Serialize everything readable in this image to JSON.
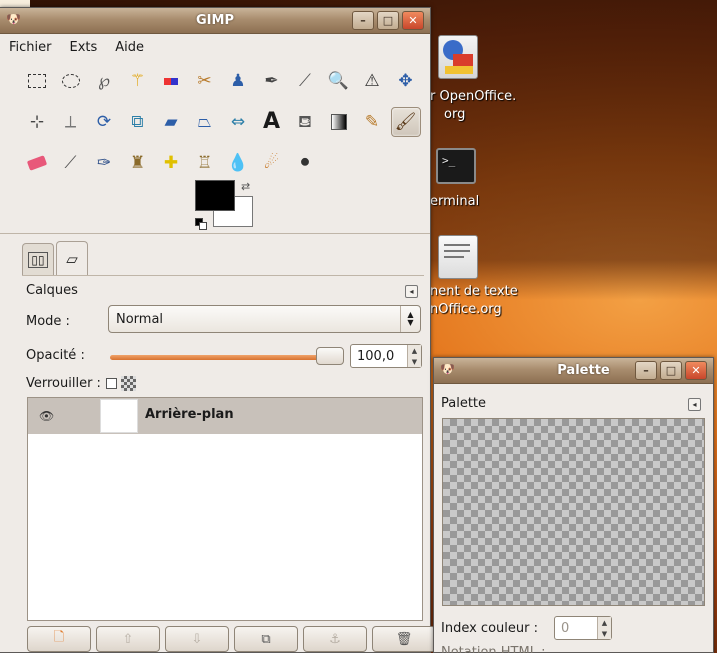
{
  "desktop": {
    "icons": [
      {
        "label_line1": "r OpenOffice.",
        "label_line2": "org",
        "icon": "openoffice-calc-icon"
      },
      {
        "label_line1": "erminal",
        "label_line2": "",
        "icon": "terminal-icon"
      },
      {
        "label_line1": "nent de texte",
        "label_line2": "nOffice.org",
        "icon": "openoffice-writer-icon"
      }
    ],
    "colors": {
      "wallpaper": "#e3741b",
      "panel": "#efebe7"
    }
  },
  "gimp": {
    "title": "GIMP",
    "menu": [
      "Fichier",
      "Exts",
      "Aide"
    ],
    "tools": [
      [
        "rect-select-icon",
        "ellipse-select-icon",
        "free-select-icon",
        "fuzzy-select-icon",
        "select-by-color-icon",
        "scissors-icon",
        "foreground-select-icon",
        "paths-icon",
        "color-picker-icon",
        "zoom-icon",
        "measure-icon"
      ],
      [
        "move-icon",
        "align-icon",
        "crop-icon",
        "rotate-icon",
        "scale-icon",
        "shear-icon",
        "perspective-icon",
        "flip-icon",
        "text-icon",
        "bucket-fill-icon",
        "blend-icon"
      ],
      [
        "pencil-icon",
        "paintbrush-icon",
        "eraser-icon",
        "airbrush-icon",
        "ink-icon",
        "clone-icon",
        "heal-icon",
        "perspective-clone-icon",
        "blur-icon",
        "smudge-icon",
        "dodge-burn-icon"
      ]
    ],
    "active_tool": "paintbrush-icon",
    "fg_color": "#000000",
    "bg_color": "#ffffff",
    "layers": {
      "title": "Calques",
      "mode_label": "Mode :",
      "mode_value": "Normal",
      "opacity_label": "Opacité :",
      "opacity_value": "100,0",
      "opacity_fraction": 1.0,
      "lock_label": "Verrouiller :",
      "items": [
        {
          "name": "Arrière-plan",
          "visible": true
        }
      ]
    }
  },
  "palette": {
    "title": "Palette",
    "header": "Palette",
    "index_label": "Index couleur :",
    "index_value": "0",
    "hex_label": "Notation HTML :"
  }
}
